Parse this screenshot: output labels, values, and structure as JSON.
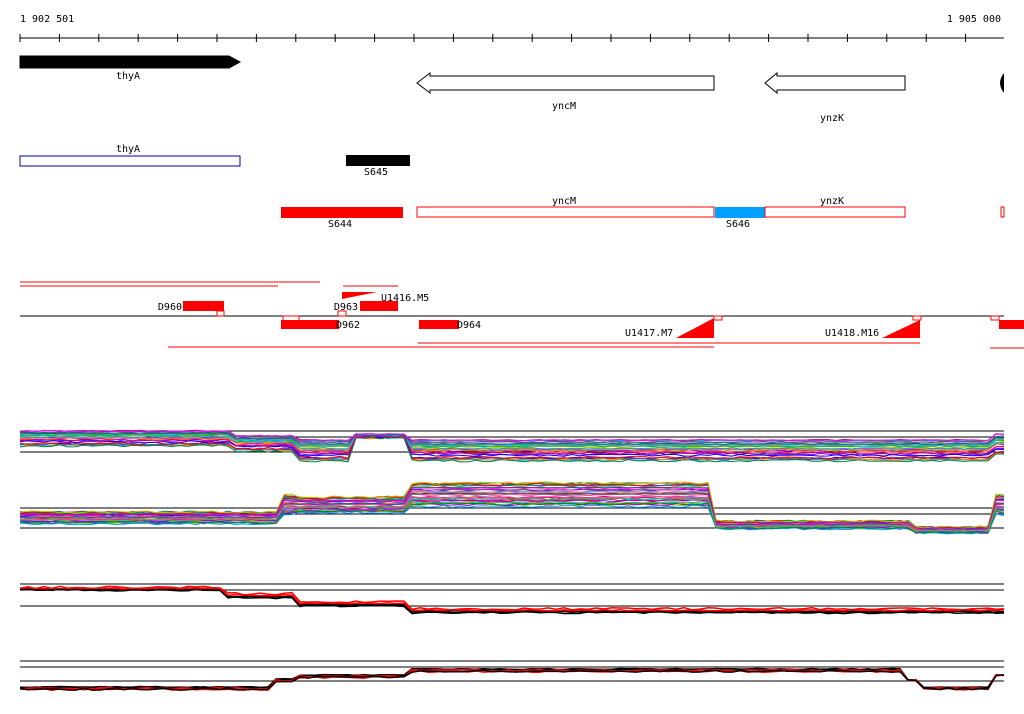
{
  "ruler": {
    "start_label": "1 902 501",
    "end_label": "1 905 000"
  },
  "genes": [
    {
      "label": "thyA",
      "style": "filled"
    },
    {
      "label": "yncM",
      "style": "outline"
    },
    {
      "label": "ynzK",
      "style": "outline"
    }
  ],
  "cds": {
    "label": "thyA"
  },
  "segments": [
    {
      "label": "S645",
      "color": "#000000"
    },
    {
      "label": "S644",
      "color": "#ff0000"
    },
    {
      "label": "yncM",
      "color": "#ff0000"
    },
    {
      "label": "S646",
      "color": "#00a0ff"
    },
    {
      "label": "ynzK",
      "color": "#ff0000"
    }
  ],
  "features": [
    {
      "label": "D960"
    },
    {
      "label": "D963"
    },
    {
      "label": "U1416.M5"
    },
    {
      "label": "D962"
    },
    {
      "label": "D964"
    },
    {
      "label": "U1417.M7"
    },
    {
      "label": "U1418.M16"
    }
  ],
  "colors": {
    "accent_red": "#ff0000",
    "accent_blue": "#00a0ff",
    "cds_outline": "#0000a0"
  }
}
